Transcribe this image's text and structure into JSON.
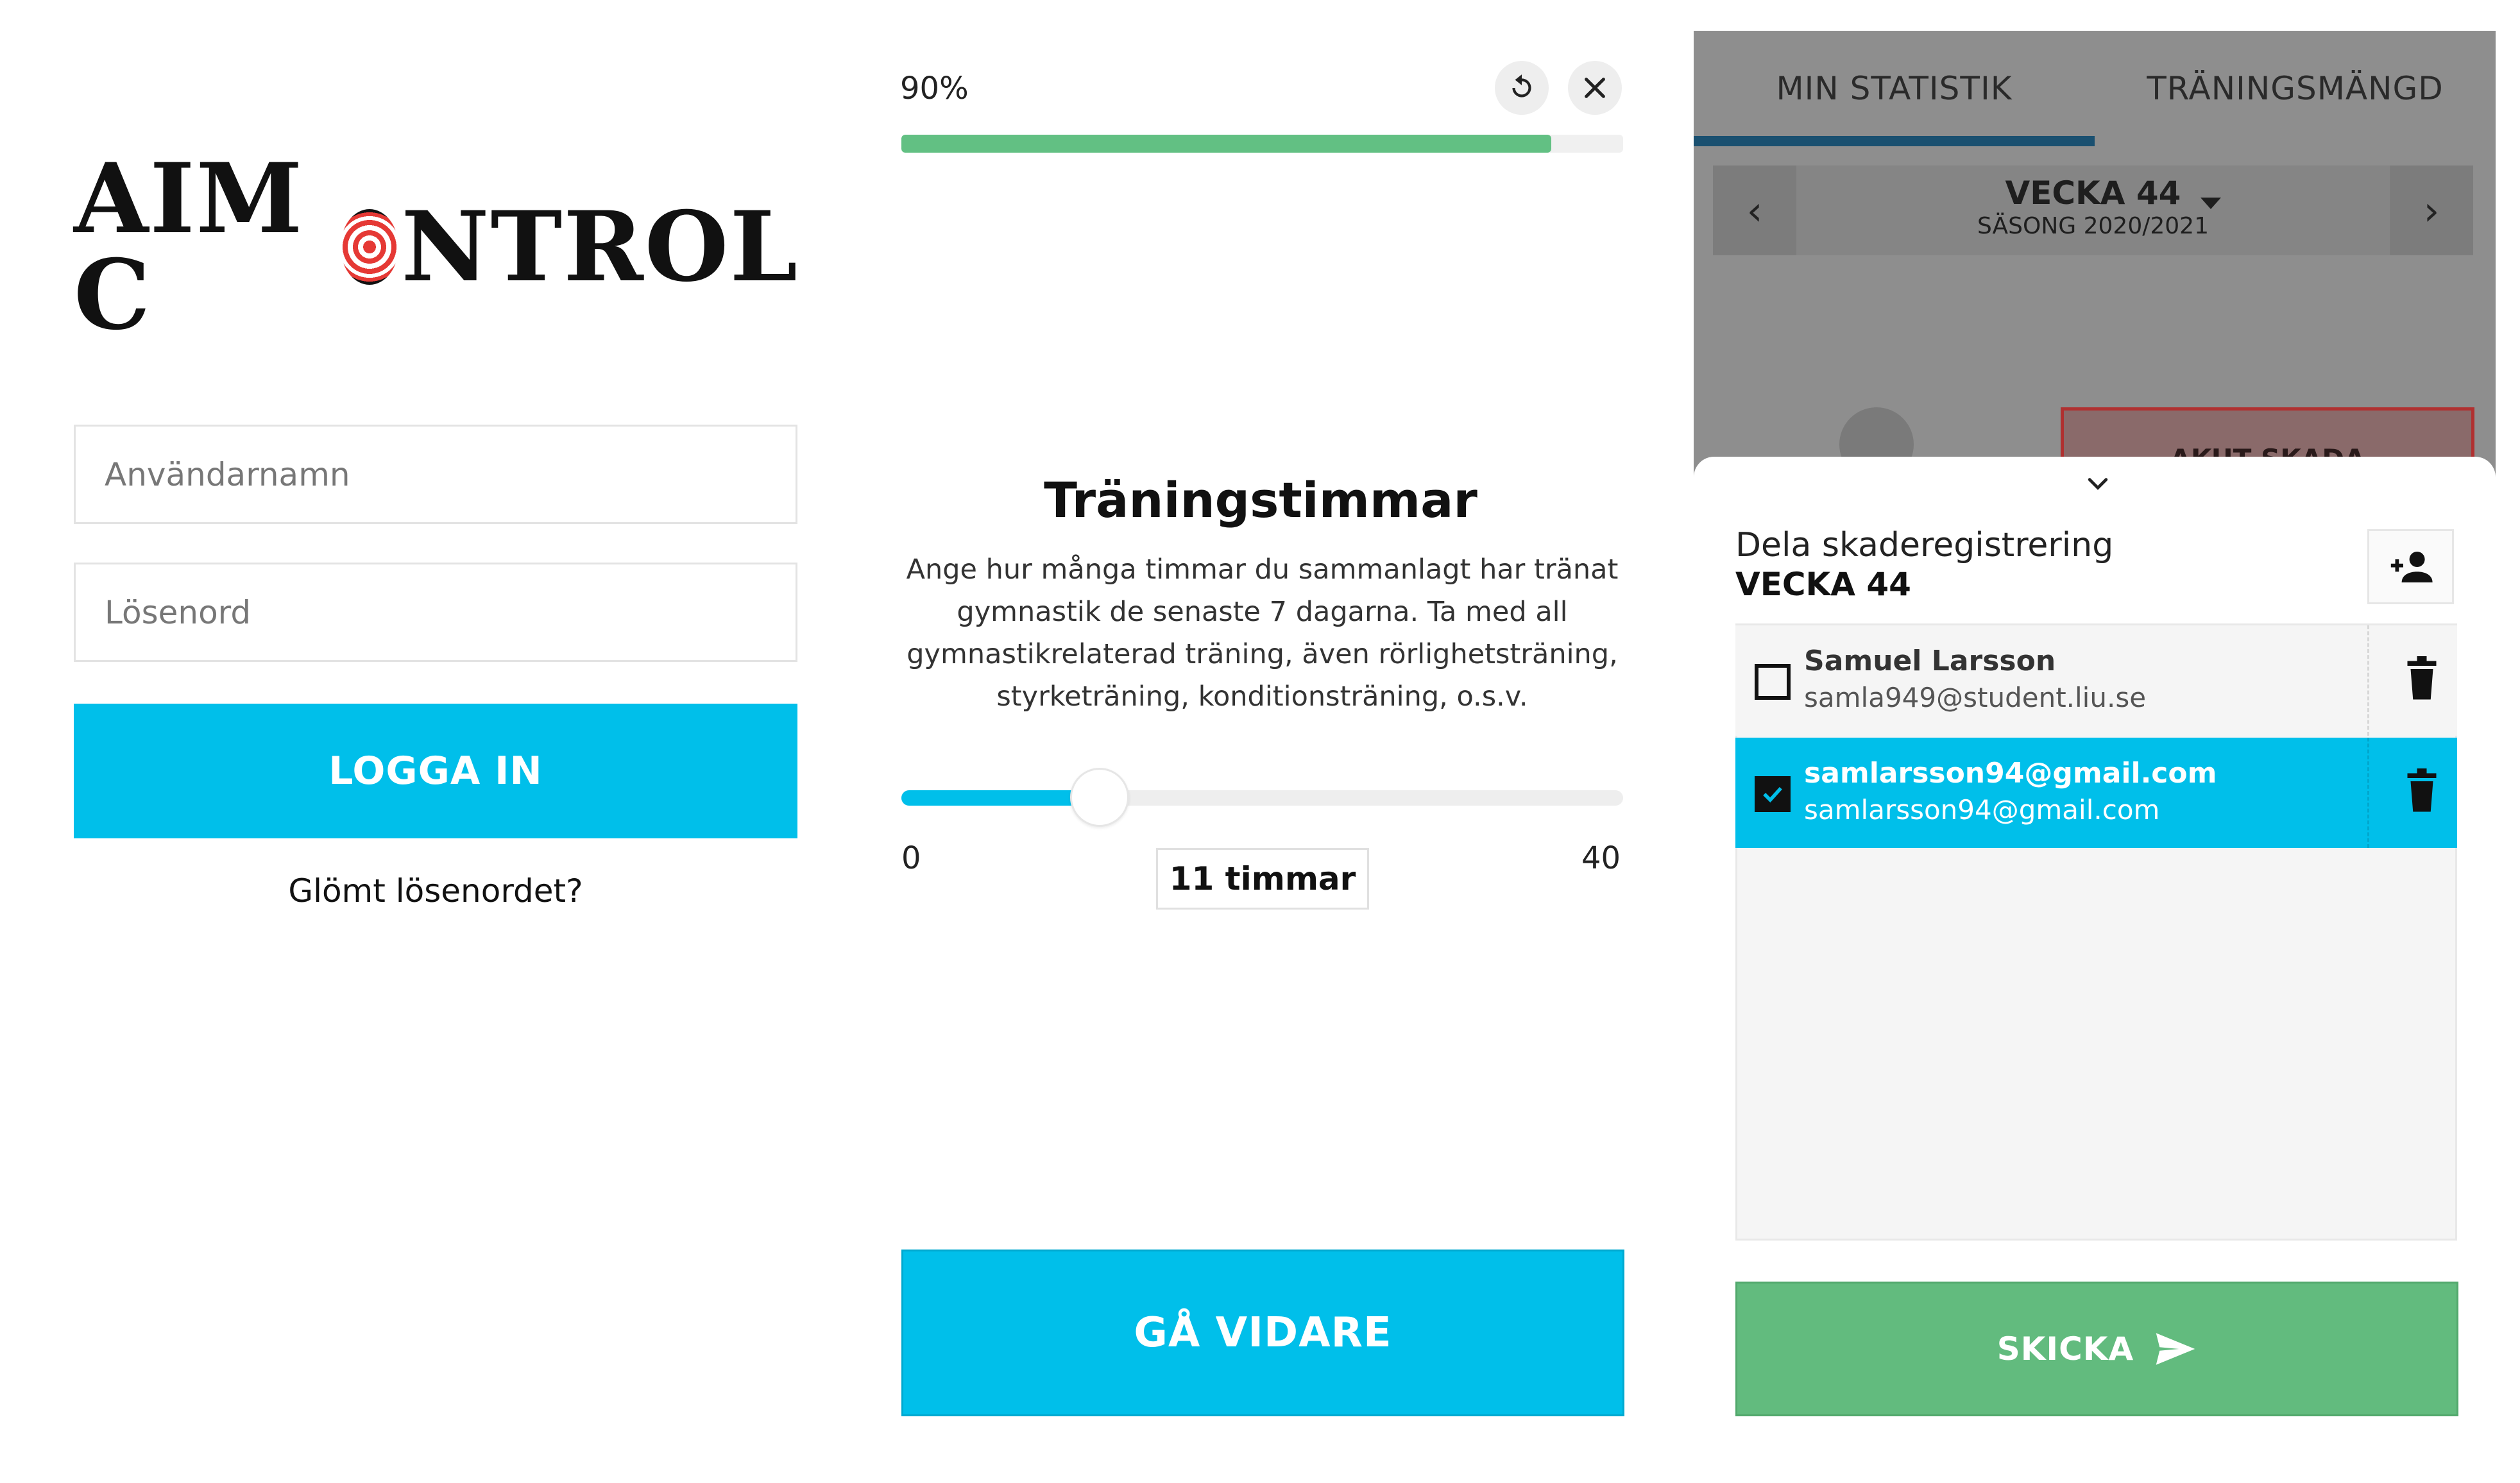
{
  "login": {
    "logo_left": "AIM C",
    "logo_right": "NTROL",
    "username_placeholder": "Användarnamn",
    "password_placeholder": "Lösenord",
    "login_button": "LOGGA IN",
    "forgot_link": "Glömt lösenordet?"
  },
  "survey": {
    "progress_label": "90%",
    "progress_fraction": 0.9,
    "title": "Träningstimmar",
    "description": "Ange hur många timmar du sammanlagt har tränat gymnastik de senaste 7 dagarna. Ta med all gymnastikrelaterad träning, även rörlighetsträning, styrketräning, konditionsträning, o.s.v.",
    "slider": {
      "min_label": "0",
      "max_label": "40",
      "min": 0,
      "max": 40,
      "value": 11,
      "value_label": "11 timmar"
    },
    "continue_button": "GÅ VIDARE",
    "icons": [
      "reset-icon",
      "close-icon"
    ]
  },
  "stats": {
    "tabs": [
      {
        "label": "MIN STATISTIK",
        "active": true
      },
      {
        "label": "TRÄNINGSMÄNGD",
        "active": false
      }
    ],
    "week_selector": {
      "title": "VECKA 44",
      "subtitle": "SÄSONG 2020/2021"
    },
    "acute_button": "AKUT SKADA",
    "share_sheet": {
      "title": "Dela skaderegistrering",
      "week": "VECKA 44",
      "recipients": [
        {
          "name": "Samuel Larsson",
          "email": "samla949@student.liu.se",
          "checked": false
        },
        {
          "name": "samlarsson94@gmail.com",
          "email": "samlarsson94@gmail.com",
          "checked": true
        }
      ],
      "send_button": "SKICKA"
    }
  },
  "colors": {
    "accent_blue": "#00bfea",
    "progress_green": "#62c083",
    "send_green": "#62bb7e",
    "tab_indicator": "#1a5070"
  }
}
